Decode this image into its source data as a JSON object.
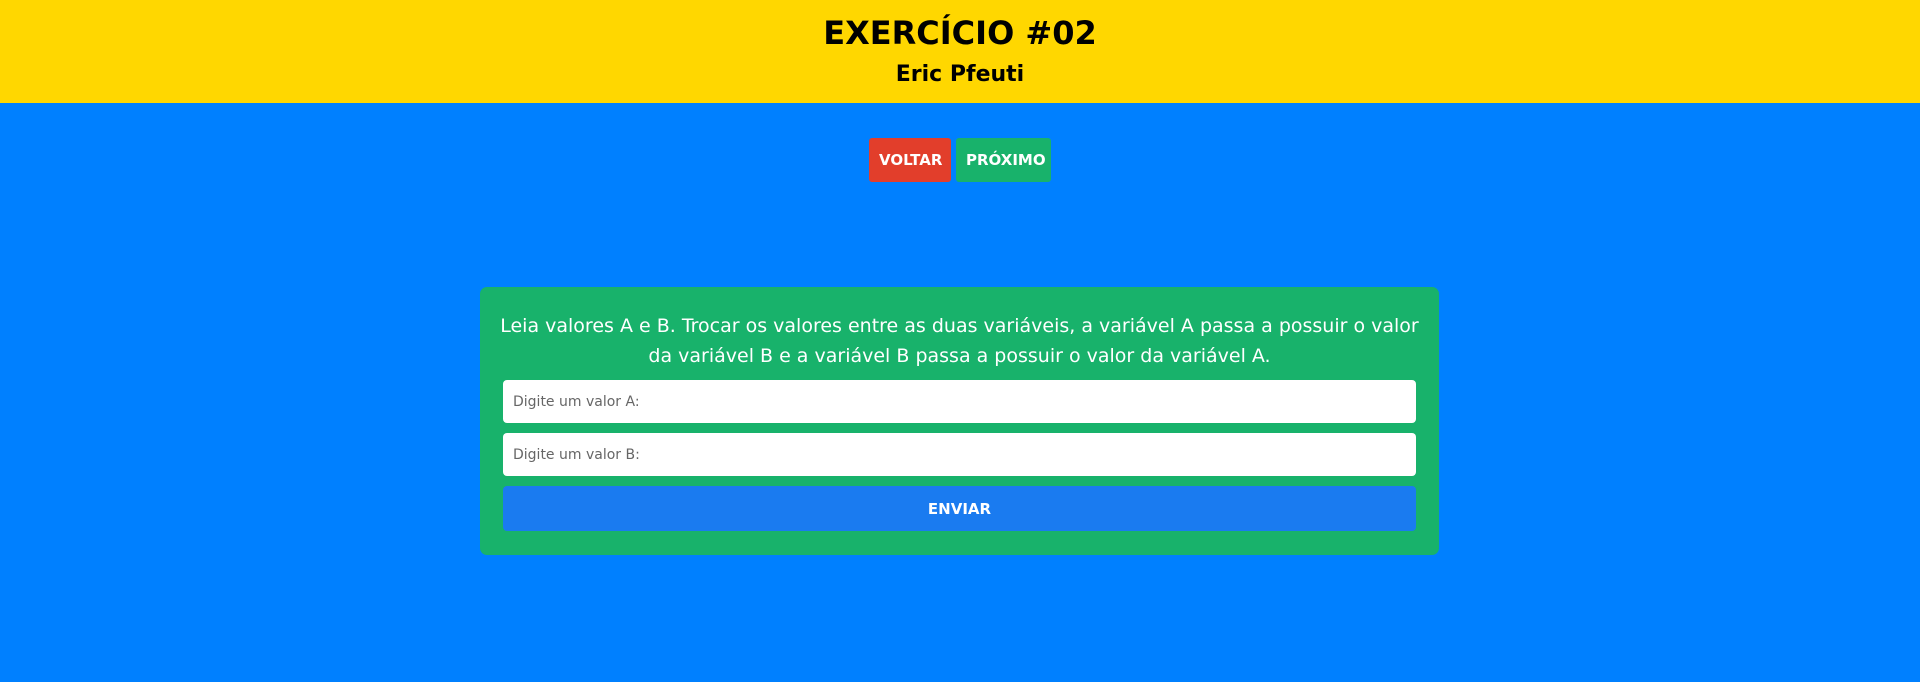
{
  "header": {
    "title": "EXERCÍCIO #02",
    "author": "Eric Pfeuti"
  },
  "nav": {
    "back_label": "VOLTAR",
    "next_label": "PRÓXIMO"
  },
  "card": {
    "description": "Leia valores A e B. Trocar os valores entre as duas variáveis, a variável A passa a possuir o valor da variável B e a variável B passa a possuir o valor da variável A.",
    "input_a": {
      "value": "",
      "placeholder": "Digite um valor A:"
    },
    "input_b": {
      "value": "",
      "placeholder": "Digite um valor B:"
    },
    "submit_label": "ENVIAR"
  },
  "colors": {
    "header_bg": "#FFD700",
    "page_bg": "#0080FF",
    "card_bg": "#18B26B",
    "back_button": "#E23E2B",
    "next_button": "#18B26B",
    "submit_button": "#1A7BF0"
  }
}
